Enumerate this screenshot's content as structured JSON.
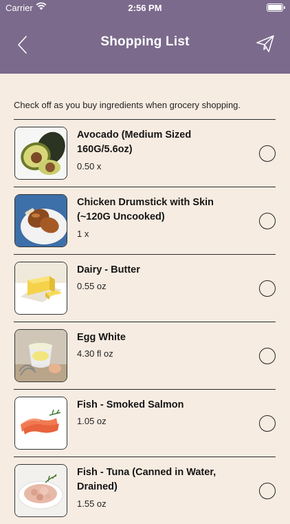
{
  "status": {
    "carrier": "Carrier",
    "time": "2:56 PM"
  },
  "nav": {
    "title": "Shopping List"
  },
  "intro": "Check off as you buy ingredients when grocery shopping.",
  "items": [
    {
      "name": "Avocado (Medium Sized 160G/5.6oz)",
      "qty": "0.50 x",
      "image": "avocado",
      "checked": false
    },
    {
      "name": "Chicken Drumstick with Skin (~120G Uncooked)",
      "qty": "1 x",
      "image": "chicken-drumstick",
      "checked": false
    },
    {
      "name": "Dairy - Butter",
      "qty": "0.55 oz",
      "image": "butter",
      "checked": false
    },
    {
      "name": "Egg White",
      "qty": "4.30 fl oz",
      "image": "egg-white",
      "checked": false
    },
    {
      "name": "Fish - Smoked Salmon",
      "qty": "1.05 oz",
      "image": "smoked-salmon",
      "checked": false
    },
    {
      "name": "Fish - Tuna (Canned in Water, Drained)",
      "qty": "1.55 oz",
      "image": "tuna",
      "checked": false
    }
  ]
}
